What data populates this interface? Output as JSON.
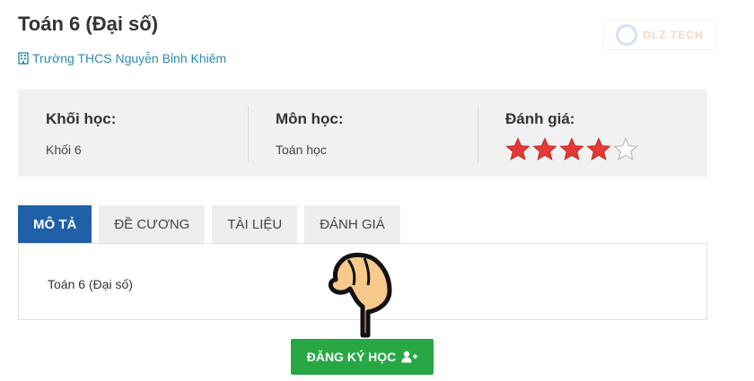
{
  "course": {
    "title": "Toán 6 (Đại số)",
    "school": "Trường THCS Nguyễn Bỉnh Khiêm"
  },
  "watermark": {
    "text": "DLZ TECH"
  },
  "info": {
    "grade_label": "Khối học:",
    "grade_value": "Khối 6",
    "subject_label": "Môn học:",
    "subject_value": "Toán học",
    "rating_label": "Đánh giá:",
    "rating_value": 4,
    "rating_max": 5
  },
  "tabs": [
    {
      "label": "MÔ TẢ",
      "active": true
    },
    {
      "label": "ĐỀ CƯƠNG",
      "active": false
    },
    {
      "label": "TÀI LIỆU",
      "active": false
    },
    {
      "label": "ĐÁNH GIÁ",
      "active": false
    }
  ],
  "description": "Toán 6 (Đại số)",
  "register_button": {
    "label": "ĐĂNG KÝ HỌC",
    "icon": "user-plus-icon"
  },
  "colors": {
    "accent": "#2060a8",
    "button": "#27a844",
    "link": "#2a8ab0",
    "star": "#e53935"
  },
  "icons": {
    "school": "building-icon",
    "star": "star-icon",
    "pointer": "pointing-hand-icon"
  }
}
